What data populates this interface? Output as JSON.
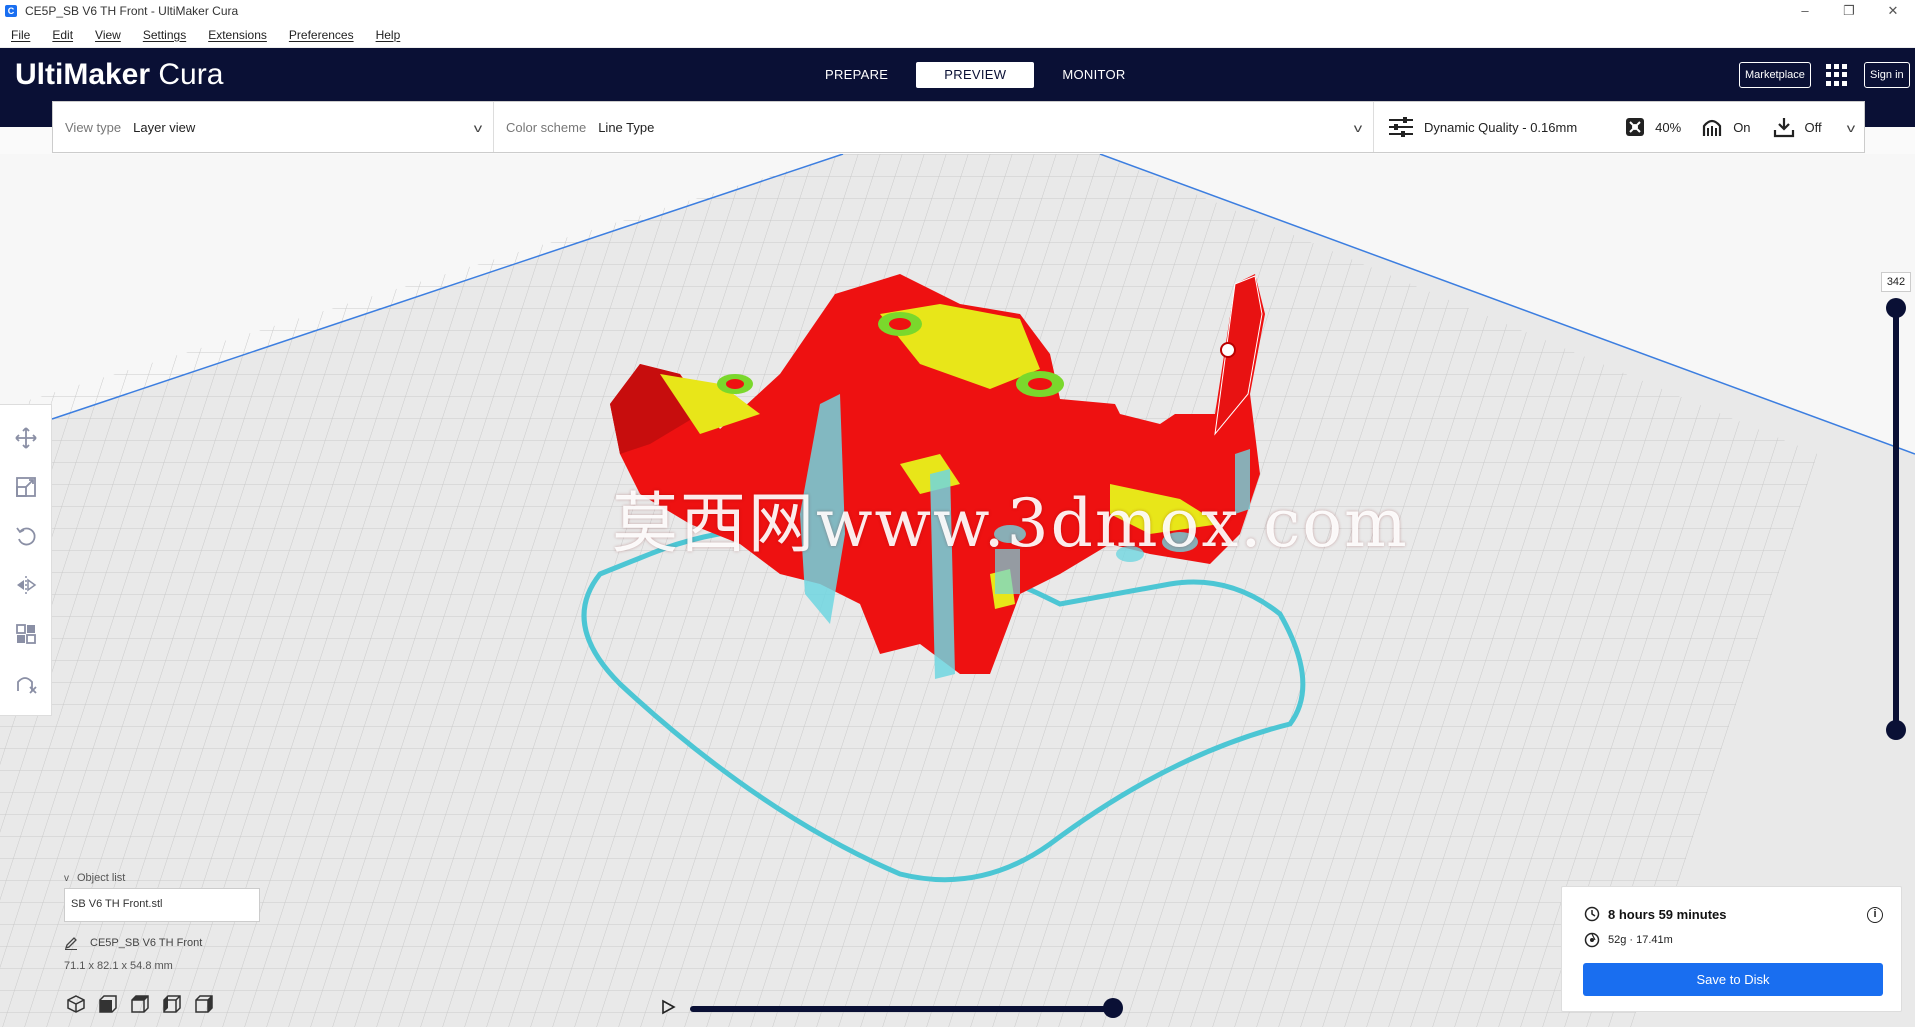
{
  "window": {
    "title": "CE5P_SB V6 TH Front - UltiMaker Cura",
    "minimize": "–",
    "restore": "❐",
    "close": "✕"
  },
  "menu": [
    "File",
    "Edit",
    "View",
    "Settings",
    "Extensions",
    "Preferences",
    "Help"
  ],
  "header": {
    "logo_bold": "UltiMaker",
    "logo_light": "Cura",
    "tabs": [
      {
        "label": "PREPARE",
        "active": false
      },
      {
        "label": "PREVIEW",
        "active": true
      },
      {
        "label": "MONITOR",
        "active": false
      }
    ],
    "marketplace": "Marketplace",
    "sign_in": "Sign in",
    "apps_icon": "grid-icon"
  },
  "toolbar": {
    "view_type_label": "View type",
    "view_type_value": "Layer view",
    "color_scheme_label": "Color scheme",
    "color_scheme_value": "Line Type",
    "profile": "Dynamic Quality - 0.16mm",
    "infill": "40%",
    "support": "On",
    "adhesion": "Off"
  },
  "left_tools": [
    "move-icon",
    "scale-icon",
    "rotate-icon",
    "mirror-icon",
    "per-model-settings-icon",
    "support-blocker-icon"
  ],
  "layer_slider": {
    "max_layer": "342"
  },
  "object_list": {
    "title": "Object list",
    "file": "SB V6 TH Front.stl",
    "job_name": "CE5P_SB V6 TH Front",
    "dimensions": "71.1 x 82.1 x 54.8 mm"
  },
  "view_modes": [
    "3d-view-icon",
    "front-view-icon",
    "top-view-icon",
    "left-view-icon",
    "right-view-icon"
  ],
  "print_info": {
    "time": "8 hours 59 minutes",
    "material": "52g · 17.41m",
    "save_label": "Save to Disk"
  },
  "watermark": "莫西网www.3dmox.com",
  "colors": {
    "header_bg": "#0a1035",
    "accent_blue": "#196ef0",
    "model_red": "#ee1111",
    "infill_yellow": "#e8e619",
    "support_cyan": "#6fd6e0"
  }
}
